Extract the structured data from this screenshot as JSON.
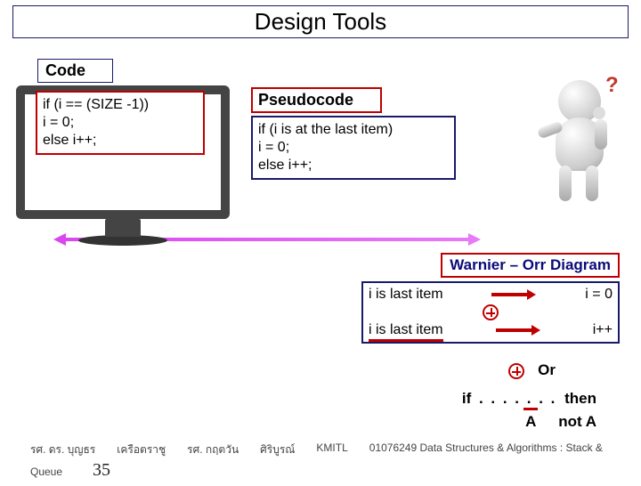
{
  "title": "Design Tools",
  "code": {
    "label": "Code",
    "body": "if (i == (SIZE -1))\n  i = 0;\nelse i++;"
  },
  "pseudo": {
    "label": "Pseudocode",
    "body": "if (i is at the last item)\n  i = 0;\nelse i++;"
  },
  "warnier": {
    "label": "Warnier – Orr Diagram",
    "row1_left": "i is last item",
    "row1_right": "i = 0",
    "row2_left": "i is last item",
    "row2_right": "i++"
  },
  "legend": {
    "or": "Or",
    "if": "if",
    "then": "then",
    "dots": ". . . . . . .",
    "A": "A",
    "notA": "not A"
  },
  "footer": {
    "a1": "รศ. ดร. บุญธร",
    "a2": "เครือตราชู",
    "a3": "รศ. กฤตวัน",
    "a4": "ศิริบูรณ์",
    "inst": "KMITL",
    "course": "01076249 Data Structures & Algorithms : Stack &",
    "queue": "Queue",
    "page": "35"
  }
}
